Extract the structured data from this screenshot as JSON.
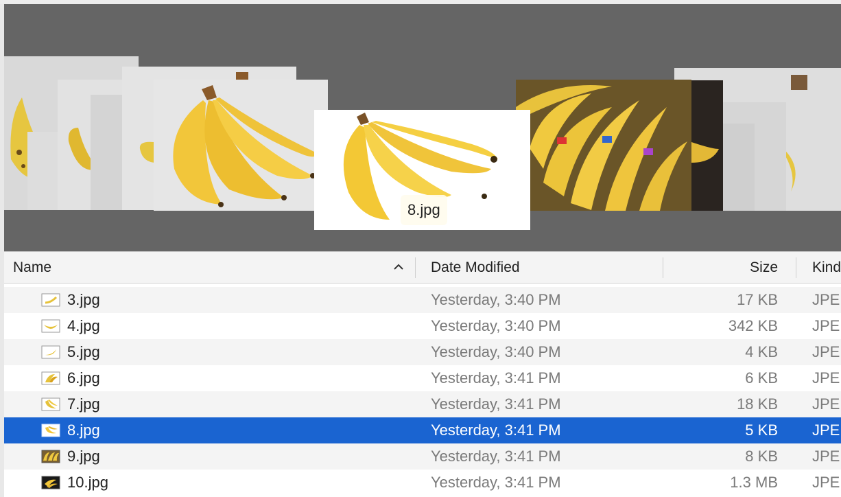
{
  "coverflow": {
    "caption": "8.jpg",
    "colors": {
      "background": "#656565",
      "banana": "#f2c63a",
      "banana_shadow": "#d9a21c",
      "stem": "#8a5a2a"
    }
  },
  "columns": {
    "name": "Name",
    "date": "Date Modified",
    "size": "Size",
    "kind": "Kind"
  },
  "sort_indicator": "chevron-up-icon",
  "files": [
    {
      "name": "3.jpg",
      "date": "Yesterday, 3:40 PM",
      "size": "17 KB",
      "kind": "JPE",
      "selected": false
    },
    {
      "name": "4.jpg",
      "date": "Yesterday, 3:40 PM",
      "size": "342 KB",
      "kind": "JPE",
      "selected": false
    },
    {
      "name": "5.jpg",
      "date": "Yesterday, 3:40 PM",
      "size": "4 KB",
      "kind": "JPE",
      "selected": false
    },
    {
      "name": "6.jpg",
      "date": "Yesterday, 3:41 PM",
      "size": "6 KB",
      "kind": "JPE",
      "selected": false
    },
    {
      "name": "7.jpg",
      "date": "Yesterday, 3:41 PM",
      "size": "18 KB",
      "kind": "JPE",
      "selected": false
    },
    {
      "name": "8.jpg",
      "date": "Yesterday, 3:41 PM",
      "size": "5 KB",
      "kind": "JPE",
      "selected": true
    },
    {
      "name": "9.jpg",
      "date": "Yesterday, 3:41 PM",
      "size": "8 KB",
      "kind": "JPE",
      "selected": false
    },
    {
      "name": "10.jpg",
      "date": "Yesterday, 3:41 PM",
      "size": "1.3 MB",
      "kind": "JPE",
      "selected": false
    }
  ],
  "selection_color": "#1a64d1"
}
